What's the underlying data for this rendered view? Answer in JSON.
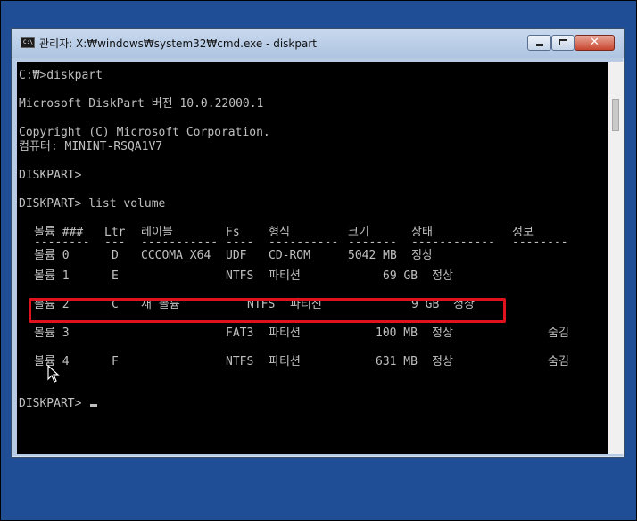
{
  "window": {
    "title": "관리자: X:₩windows₩system32₩cmd.exe - diskpart",
    "icon_label": "C:\\"
  },
  "console": {
    "lines": [
      "C:₩>diskpart",
      "Microsoft DiskPart 버전 10.0.22000.1",
      "Copyright (C) Microsoft Corporation.",
      "컴퓨터: MININT-RSQA1V7",
      "DISKPART>",
      "DISKPART> list volume",
      "DISKPART> "
    ],
    "table": {
      "headers": [
        "볼륨 ###",
        "Ltr",
        "레이블",
        "Fs",
        "형식",
        "크기",
        "상태",
        "정보"
      ],
      "separators": [
        "--------",
        "---",
        "-----------",
        "----",
        "----------",
        "-------",
        "------------",
        "--------"
      ],
      "rows": [
        [
          "볼륨 0",
          "D",
          "CCCOMA_X64",
          "UDF",
          "CD-ROM",
          "5042 MB",
          "정상",
          ""
        ],
        [
          "볼륨 1",
          "E",
          "",
          "NTFS",
          "파티션",
          "69 GB",
          "정상",
          ""
        ],
        [
          "볼륨 2",
          "C",
          "새 볼륨",
          "NTFS",
          "파티션",
          "9 GB",
          "정상",
          ""
        ],
        [
          "볼륨 3",
          "",
          "",
          "FAT3",
          "파티션",
          "100 MB",
          "정상",
          "숨김"
        ],
        [
          "볼륨 4",
          "F",
          "",
          "NTFS",
          "파티션",
          "631 MB",
          "정상",
          "숨김"
        ]
      ]
    }
  },
  "colors": {
    "desktop": "#1f4e96",
    "console_bg": "#000000",
    "console_fg": "#c0c0c0",
    "highlight": "#e0121e"
  },
  "icons": {
    "app": "cmd-icon",
    "minimize": "minimize-icon",
    "maximize": "maximize-icon",
    "close": "close-icon",
    "pointer": "mouse-pointer-icon"
  }
}
